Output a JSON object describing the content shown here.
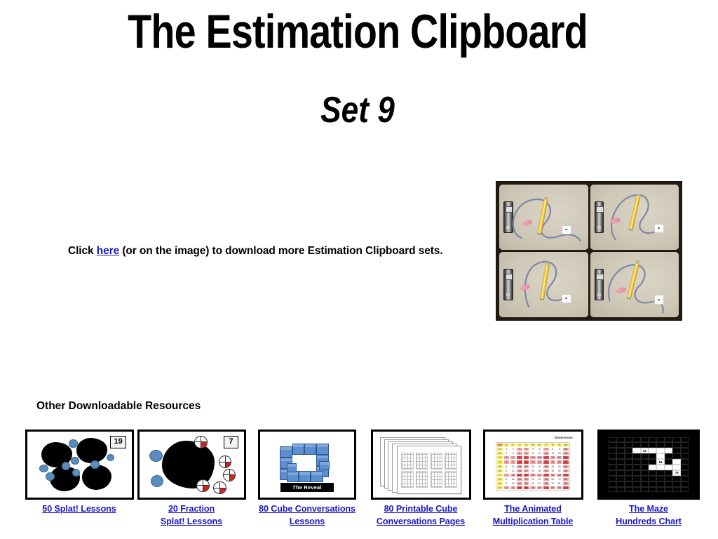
{
  "slide": {
    "title": "The Estimation Clipboard",
    "subtitle": "Set 9",
    "background_color": "#ffffff",
    "link_color": "#1a18c6"
  },
  "click_line": {
    "before": "Click ",
    "link_text": "here",
    "after": " (or on the image) to download more Estimation Clipboard sets."
  },
  "clipboard_image": {
    "alt": "Four photos of a clipboard with a blue string loop, yellow pencil, pink eraser and a white die",
    "panel_count": 4,
    "objects": [
      "string",
      "pencil",
      "eraser",
      "die",
      "clip"
    ],
    "frame_color": "#241a14",
    "board_color": "#cfc8b8"
  },
  "resources": {
    "heading": "Other Downloadable Resources",
    "items": [
      {
        "caption_line1": "50 Splat! Lessons ",
        "caption_line2": "",
        "thumb": "splat",
        "badge": "19"
      },
      {
        "caption_line1": "20 Fraction ",
        "caption_line2": "Splat! Lessons",
        "thumb": "fraction-splat",
        "badge": "7"
      },
      {
        "caption_line1": "80 Cube Conversations",
        "caption_line2": "Lessons",
        "thumb": "cube-reveal",
        "reveal_label": "The Reveal"
      },
      {
        "caption_line1": "80 Printable Cube",
        "caption_line2": "Conversations Pages",
        "thumb": "printable-pages"
      },
      {
        "caption_line1": "The Animated",
        "caption_line2": "Multiplication Table",
        "thumb": "multiplication-table",
        "table_title": "Dimensions"
      },
      {
        "caption_line1": "The Maze ",
        "caption_line2": "Hundreds Chart",
        "thumb": "maze-hundreds-chart",
        "maze_numbers": [
          "34",
          "56",
          "78"
        ]
      }
    ]
  }
}
